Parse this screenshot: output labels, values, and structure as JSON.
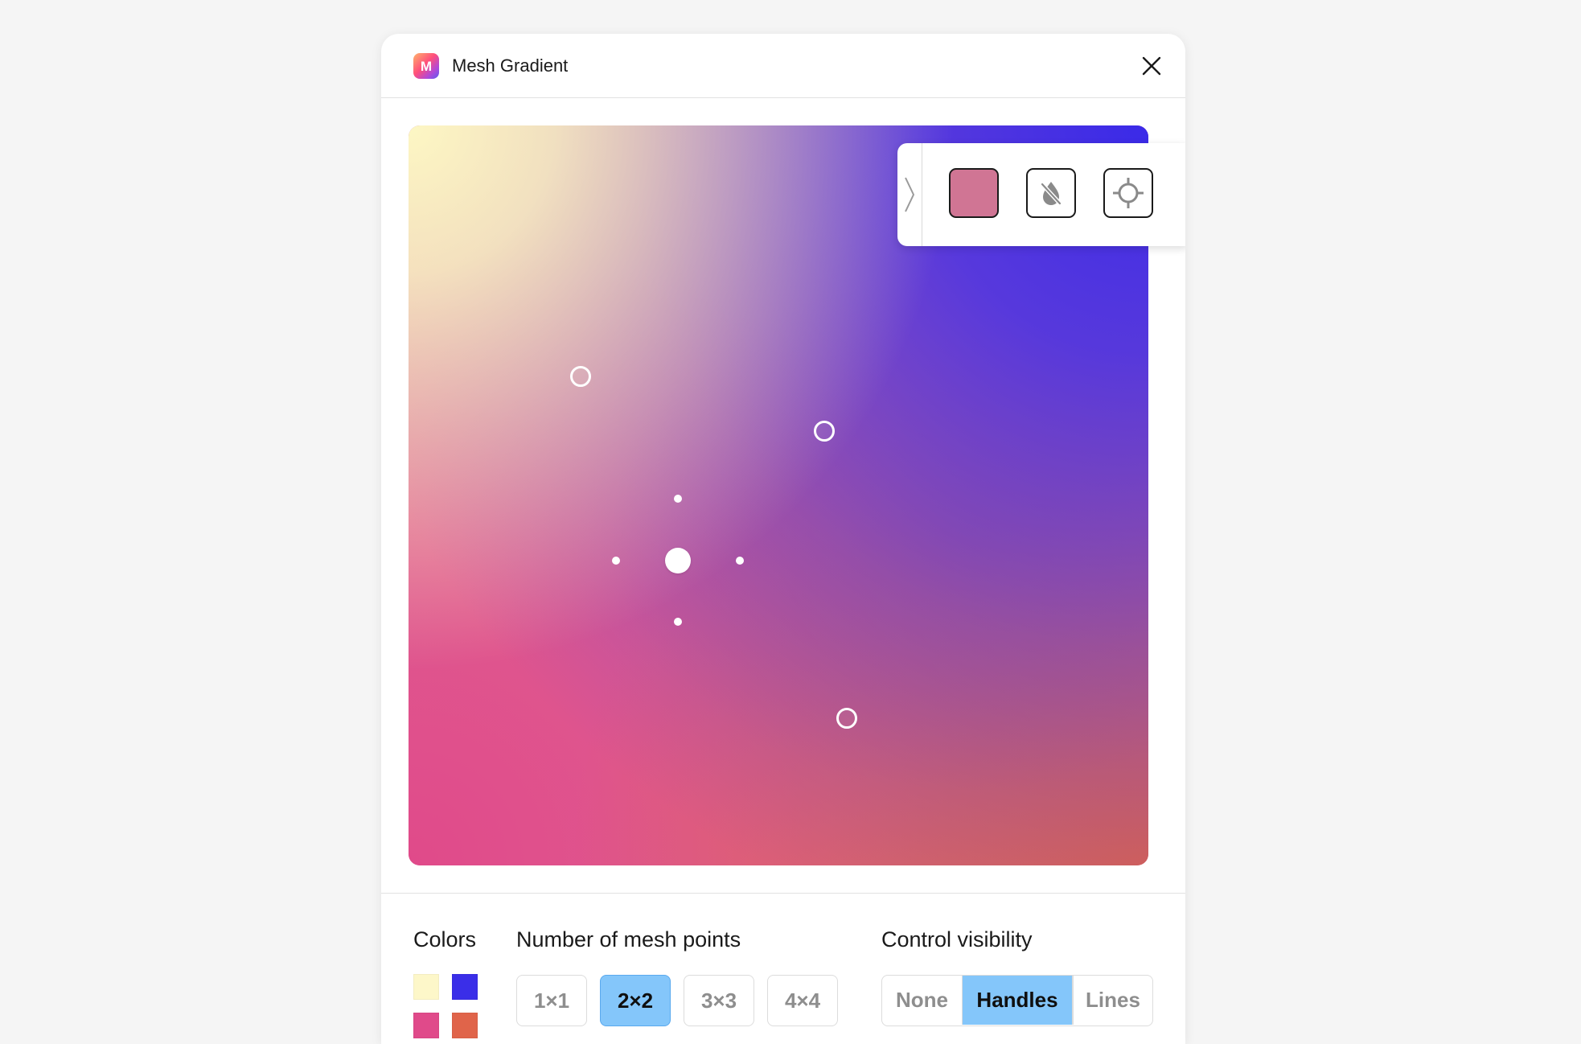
{
  "window": {
    "title": "Mesh Gradient",
    "app_icon_letter": "M",
    "app_icon": "app-logo-icon",
    "close_icon": "close-icon"
  },
  "canvas": {
    "corner_colors": {
      "top_left": "#fdf7c4",
      "top_right": "#3a2ae8",
      "bottom_left": "#e04a8a",
      "bottom_right": "#e0644a"
    },
    "handles": [
      "mesh-point-top-left",
      "mesh-point-top-right",
      "mesh-point-bottom-right",
      "mesh-point-center-selected"
    ]
  },
  "point_toolbar": {
    "collapse_icon": "chevron-right-icon",
    "selected_color": "#d07594",
    "tools": [
      "color-swatch",
      "opacity-off-icon",
      "crosshair-icon"
    ]
  },
  "controls": {
    "colors_label": "Colors",
    "colors": [
      "#fdf7c9",
      "#3a2ee8",
      "#e04a8a",
      "#e0644a"
    ],
    "mesh_label": "Number of mesh points",
    "mesh_options": [
      "1×1",
      "2×2",
      "3×3",
      "4×4"
    ],
    "mesh_selected": "2×2",
    "visibility_label": "Control visibility",
    "visibility_options": [
      "None",
      "Handles",
      "Lines"
    ],
    "visibility_selected": "Handles",
    "accent_color": "#84c6fa"
  }
}
